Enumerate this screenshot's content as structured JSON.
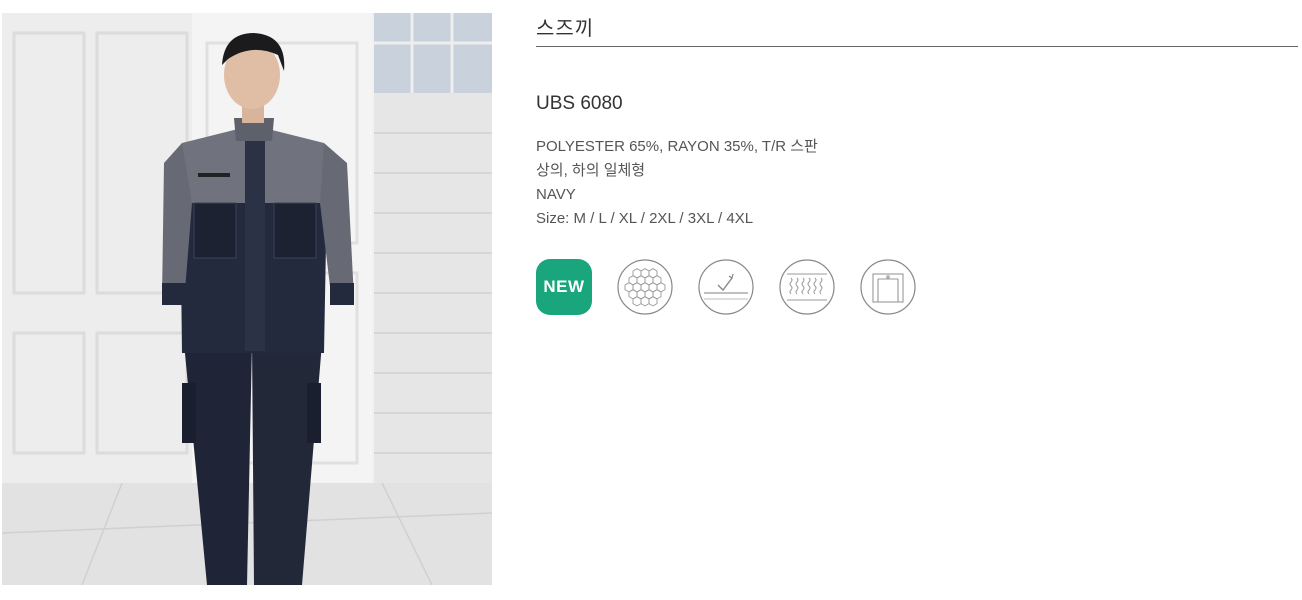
{
  "product": {
    "category": "스즈끼",
    "code": "UBS 6080",
    "material": "POLYESTER 65%, RAYON 35%, T/R 스판",
    "type": "상의, 하의 일체형",
    "color": "NAVY",
    "size": "Size: M / L / XL / 2XL / 3XL / 4XL"
  },
  "badges": {
    "new_label": "NEW",
    "new_color": "#1aa67d",
    "icons": [
      "new-badge",
      "honeycomb-fabric-icon",
      "quick-dry-icon",
      "stretch-fabric-icon",
      "pocket-icon"
    ]
  },
  "image": {
    "subject": "man-wearing-navy-coverall-photo"
  }
}
